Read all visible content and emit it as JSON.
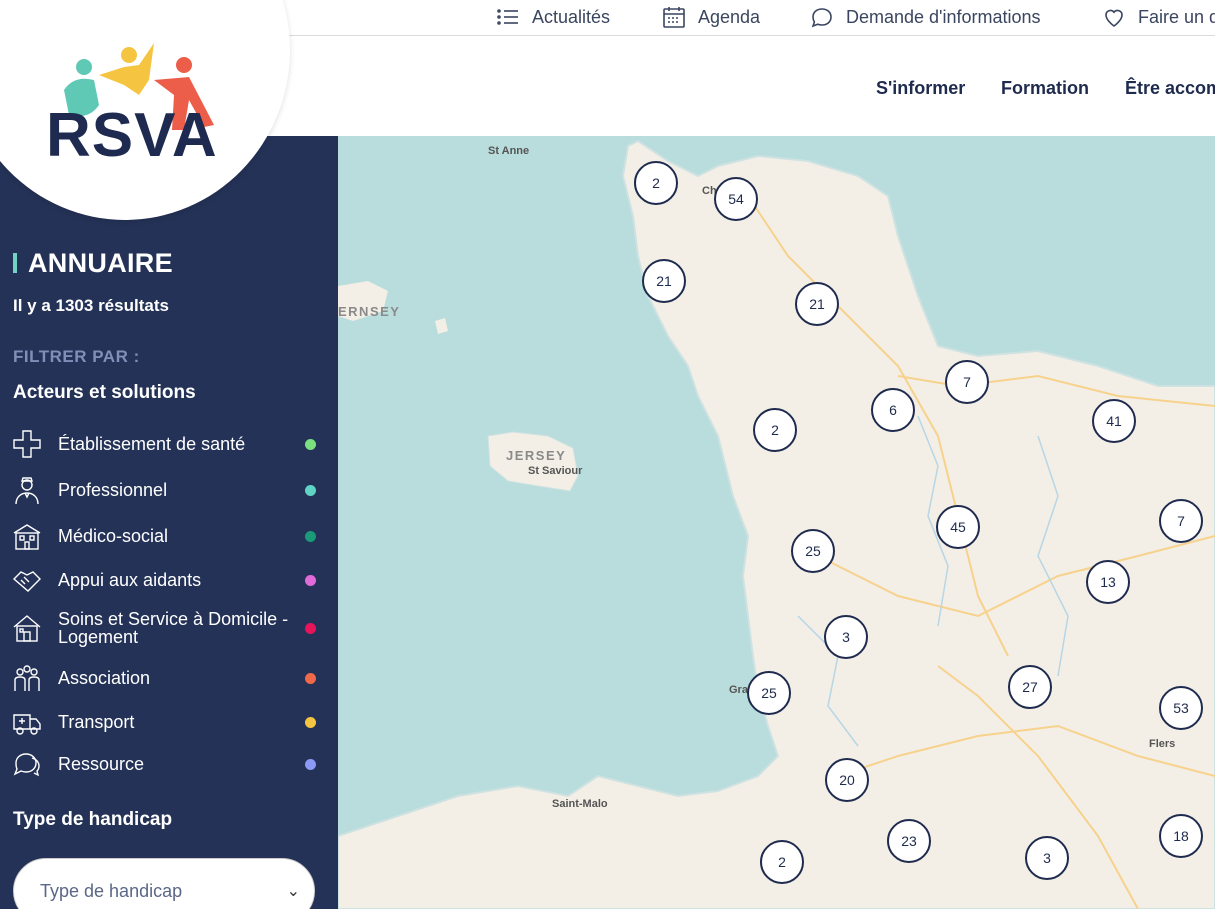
{
  "topbar": {
    "items": [
      {
        "label": "Actualités",
        "icon": "list-icon"
      },
      {
        "label": "Agenda",
        "icon": "calendar-icon"
      },
      {
        "label": "Demande d'informations",
        "icon": "chat-icon"
      },
      {
        "label": "Faire un d",
        "icon": "heart-icon"
      }
    ]
  },
  "nav": {
    "items": [
      "S'informer",
      "Formation",
      "Être accom"
    ]
  },
  "logo": {
    "text": "RSVA"
  },
  "sidebar": {
    "title": "ANNUAIRE",
    "results": "Il y a 1303 résultats",
    "filter_label": "FILTRER PAR :",
    "categories_title": "Acteurs et solutions",
    "categories": [
      {
        "label": "Établissement de santé",
        "icon": "health-cross-icon",
        "color": "#7be07f"
      },
      {
        "label": "Professionnel",
        "icon": "nurse-icon",
        "color": "#5fd4c4"
      },
      {
        "label": "Médico-social",
        "icon": "building-icon",
        "color": "#1a9a78"
      },
      {
        "label": "Appui aux aidants",
        "icon": "handshake-icon",
        "color": "#e06bd8"
      },
      {
        "label": "Soins et Service à Domicile - Logement",
        "icon": "house-icon",
        "color": "#e8145a"
      },
      {
        "label": "Association",
        "icon": "people-icon",
        "color": "#f06a4a"
      },
      {
        "label": "Transport",
        "icon": "ambulance-icon",
        "color": "#f5c542"
      },
      {
        "label": "Ressource",
        "icon": "speech-bubbles-icon",
        "color": "#8a9af5"
      }
    ],
    "handicap_title": "Type de handicap",
    "handicap_select": "Type de handicap"
  },
  "map": {
    "places": [
      "St Anne",
      "ERNSEY",
      "JERSEY",
      "St Saviour",
      "Saint-Malo",
      "Flers",
      "Ch",
      "Gra"
    ],
    "clusters": [
      "2",
      "54",
      "21",
      "21",
      "7",
      "6",
      "41",
      "2",
      "45",
      "7",
      "25",
      "13",
      "3",
      "27",
      "25",
      "53",
      "20",
      "23",
      "3",
      "2",
      "18"
    ]
  }
}
